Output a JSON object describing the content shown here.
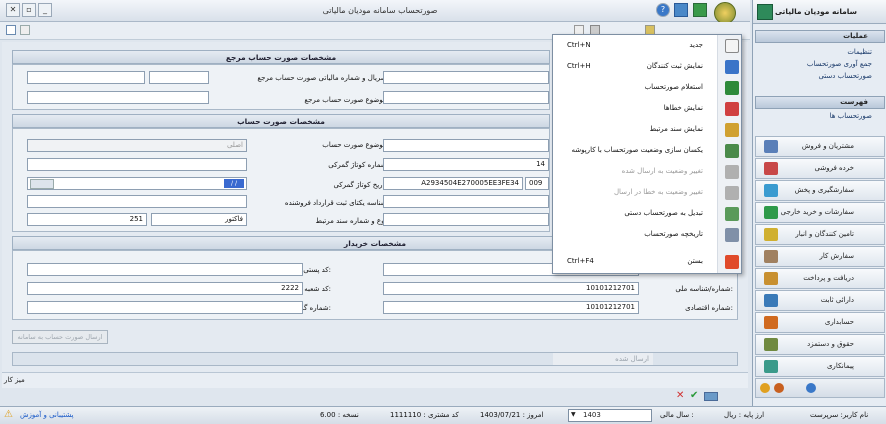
{
  "window": {
    "title": "صورتحساب سامانه مودیان مالیاتی",
    "min_label": "_",
    "max_label": "▫",
    "close_label": "✕",
    "help_label": "?"
  },
  "sidebar": {
    "app_title": "سامانه مودیان مالیاتی",
    "operations_header": "عملیات",
    "operations": [
      "تنظیمات",
      "جمع آوری صورتحساب",
      "صورتحساب دستی"
    ],
    "list_header": "فهرست",
    "list_items": [
      "صورتحساب ها"
    ],
    "nav": [
      {
        "label": "مشتریان و فروش",
        "color": "#5a7fb8"
      },
      {
        "label": "خرده فروشی",
        "color": "#c84848"
      },
      {
        "label": "سفارشگیری و پخش",
        "color": "#3a9bd0"
      },
      {
        "label": "سفارشات و خرید خارجی",
        "color": "#2e9a4a"
      },
      {
        "label": "تامین کنندگان و انبار",
        "color": "#d0b030"
      },
      {
        "label": "سفارش کار",
        "color": "#a08060"
      },
      {
        "label": "دریافت و پرداخت",
        "color": "#c89030"
      },
      {
        "label": "دارائی ثابت",
        "color": "#3a7ab8"
      },
      {
        "label": "حسابداری",
        "color": "#d06a20"
      },
      {
        "label": "حقوق و دستمزد",
        "color": "#708a40"
      },
      {
        "label": "پیمانکاری",
        "color": "#3a9a8a"
      }
    ]
  },
  "ref_panel": {
    "title": "مشخصات صورت حساب مرجع",
    "serial_label": "سریال و شماره مالیاتی صورت حساب مرجع:",
    "subject_label": "موضوع صورت حساب مرجع:",
    "serial_value": "",
    "subject_value": ""
  },
  "invoice_panel": {
    "title": "مشخصات صورت حساب",
    "subject_label": "موضوع صورت حساب:",
    "subject_value": "اصلی",
    "customs_label": "شماره کوتاژ گمرکی:",
    "customs_value": "14",
    "customs_date_label": "تاریخ کوتاژ گمرکی:",
    "customs_date_value": "/ /",
    "contract_label": "شناسه یکتای ثبت قرارداد فروشنده:",
    "related_doc_label": "نوع و شماره سند مرتبط:",
    "related_doc_type": "فاکتور",
    "related_doc_number": "251",
    "tax_id_value": "A2934504E270005EE3FE34",
    "tax_id_prefix": "009"
  },
  "buyer_panel": {
    "title": "مشخصات خریدار",
    "postal_label": "کد پستی:",
    "branch_label": "کد شعبه:",
    "branch_value": "2222",
    "passport_label": "شماره گذرنامه:",
    "national_label": "شماره/شناسه ملی:",
    "national_value": "10101212701",
    "economic_label": "شماره اقتصادی:",
    "economic_value": "10101212701"
  },
  "send_button": "ارسال صورت حساب به سامانه",
  "sent_status": "ارسال شده",
  "desk_label": "میز کار",
  "menu": {
    "items": [
      {
        "label": "جدید",
        "shortcut": "Ctrl+N",
        "color": "#f4f4f4",
        "disabled": false
      },
      {
        "label": "نمایش ثبت کنندگان",
        "shortcut": "Ctrl+H",
        "color": "#3a74c8",
        "disabled": false
      },
      {
        "label": "استعلام صورتحساب",
        "shortcut": "",
        "color": "#2e8a3a",
        "disabled": false
      },
      {
        "label": "نمایش خطاها",
        "shortcut": "",
        "color": "#d04040",
        "disabled": false
      },
      {
        "label": "نمایش سند مرتبط",
        "shortcut": "",
        "color": "#d0a030",
        "disabled": false
      },
      {
        "label": "یکسان سازی وضعیت صورتحساب با کارپوشه",
        "shortcut": "",
        "color": "#4a8a4a",
        "disabled": false
      },
      {
        "label": "تغییر وضعیت به ارسال شده",
        "shortcut": "",
        "color": "#b0b0b0",
        "disabled": true
      },
      {
        "label": "تغییر وضعیت به خطا در ارسال",
        "shortcut": "",
        "color": "#b0b0b0",
        "disabled": true
      },
      {
        "label": "تبدیل به صورتحساب دستی",
        "shortcut": "",
        "color": "#5a9a5a",
        "disabled": false
      },
      {
        "label": "تاریخچه صورتحساب",
        "shortcut": "",
        "color": "#8090a8",
        "disabled": false
      },
      {
        "label": "بستن",
        "shortcut": "Ctrl+F4",
        "color": "#e04a2a",
        "disabled": false
      }
    ]
  },
  "status": {
    "user": "نام کاربر: سرپرست",
    "currency": "ارز پایه : ریال",
    "fiscal_label": "سال مالی :",
    "fiscal_value": "1403",
    "today": "امروز : 1403/07/21",
    "customer_code": "کد مشتری : 1111110",
    "version": "نسخه : 6.00",
    "support": "پشتیبانی و آموزش"
  }
}
